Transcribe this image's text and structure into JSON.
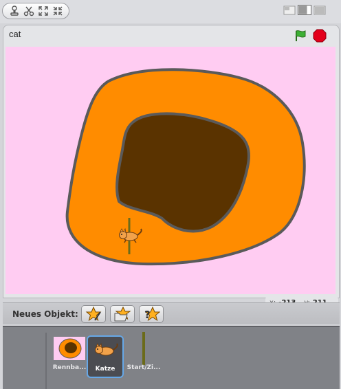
{
  "toolbar": {
    "tools": [
      {
        "name": "stamp-icon"
      },
      {
        "name": "scissors-icon"
      },
      {
        "name": "grow-icon"
      },
      {
        "name": "shrink-icon"
      }
    ],
    "view_modes": [
      {
        "name": "small-stage-icon"
      },
      {
        "name": "normal-stage-icon"
      },
      {
        "name": "presentation-icon"
      }
    ]
  },
  "stage_header": {
    "sprite_name": "cat",
    "go_icon": "green-flag-icon",
    "stop_icon": "stop-sign-icon"
  },
  "stage": {
    "background_color": "#ffccf2",
    "track_outer_color": "#ff8c00",
    "track_inner_color": "#5a3300",
    "outline_color": "#5a5a5a",
    "finish_line_color": "#6b6b1a"
  },
  "coords": {
    "x_label": "x:",
    "x_value": "-213",
    "y_label": "y:",
    "y_value": "211"
  },
  "new_sprite": {
    "label": "Neues Objekt:",
    "buttons": [
      {
        "name": "paint-new-sprite-icon"
      },
      {
        "name": "choose-sprite-file-icon"
      },
      {
        "name": "surprise-sprite-icon"
      }
    ]
  },
  "sprites": [
    {
      "label": "Rennba...",
      "selected": false
    },
    {
      "label": "Katze",
      "selected": true
    },
    {
      "label": "Start/Zi...",
      "selected": false
    }
  ]
}
